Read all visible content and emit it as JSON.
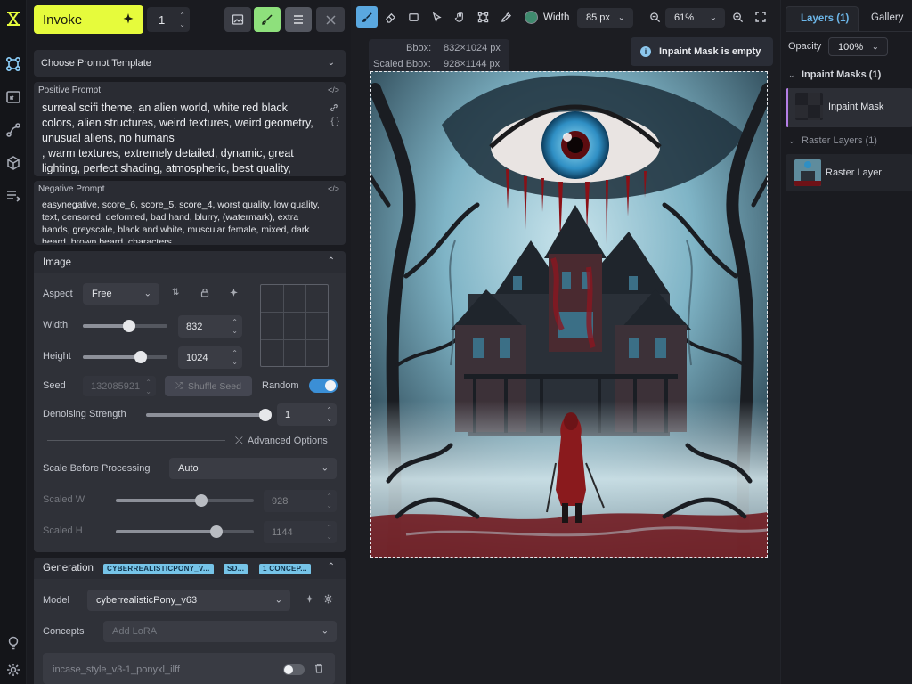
{
  "app": {
    "accent": "#e6fb3c",
    "brand_icon": "invoke-logo-icon"
  },
  "rail": {
    "icons": [
      "workflow-graph-icon",
      "canvas-icon",
      "edges-icon",
      "cube-icon",
      "queue-list-icon",
      "lightbulb-icon",
      "gear-icon"
    ]
  },
  "top": {
    "invoke_label": "Invoke",
    "iterations": "1"
  },
  "prompt_template": {
    "label": "Choose Prompt Template"
  },
  "positive": {
    "label": "Positive Prompt",
    "text": "surreal scifi theme, an alien world, white red black colors, alien structures, weird textures, weird geometry, unusual aliens, no humans\n, warm textures, extremely detailed, dynamic, great lighting, perfect shading, atmospheric, best quality,"
  },
  "negative": {
    "label": "Negative Prompt",
    "text": "easynegative, score_6, score_5, score_4, worst quality, low quality, text, censored, deformed, bad hand, blurry, (watermark), extra hands, greyscale, black and white, muscular female, mixed, dark beard, brown beard, characters"
  },
  "image": {
    "section_label": "Image",
    "aspect_label": "Aspect",
    "aspect_value": "Free",
    "width_label": "Width",
    "width_value": "832",
    "width_fraction": 0.55,
    "height_label": "Height",
    "height_value": "1024",
    "height_fraction": 0.68,
    "seed_label": "Seed",
    "seed_value": "132085921",
    "shuffle_label": "Shuffle Seed",
    "random_label": "Random",
    "denoise_label": "Denoising Strength",
    "denoise_value": "1",
    "denoise_fraction": 1.0,
    "advanced_label": "Advanced Options",
    "scale_label": "Scale Before Processing",
    "scale_value": "Auto",
    "scaled_w_label": "Scaled W",
    "scaled_w_value": "928",
    "scaled_w_fraction": 0.62,
    "scaled_h_label": "Scaled H",
    "scaled_h_value": "1144",
    "scaled_h_fraction": 0.73
  },
  "generation": {
    "section_label": "Generation",
    "tags": [
      "CYBERREALISTICPONY_V...",
      "SD...",
      "1 CONCEP..."
    ],
    "model_label": "Model",
    "model_value": "cyberrealisticPony_v63",
    "concepts_label": "Concepts",
    "concepts_placeholder": "Add LoRA",
    "lora_name": "incase_style_v3-1_ponyxl_ilff"
  },
  "toolbar": {
    "width_label": "Width",
    "width_value": "85 px",
    "zoom_value": "61%",
    "brush_color": "#3f8a6e"
  },
  "canvas": {
    "bbox_label": "Bbox:",
    "bbox_value": "832×1024 px",
    "scaled_bbox_label": "Scaled Bbox:",
    "scaled_bbox_value": "928×1144 px",
    "toast_text": "Inpaint Mask is empty"
  },
  "right": {
    "tab_layers": "Layers (1)",
    "tab_gallery": "Gallery",
    "opacity_label": "Opacity",
    "opacity_value": "100%",
    "inpaint_group": "Inpaint Masks (1)",
    "inpaint_item": "Inpaint Mask",
    "raster_group": "Raster Layers (1)",
    "raster_item": "Raster Layer"
  }
}
